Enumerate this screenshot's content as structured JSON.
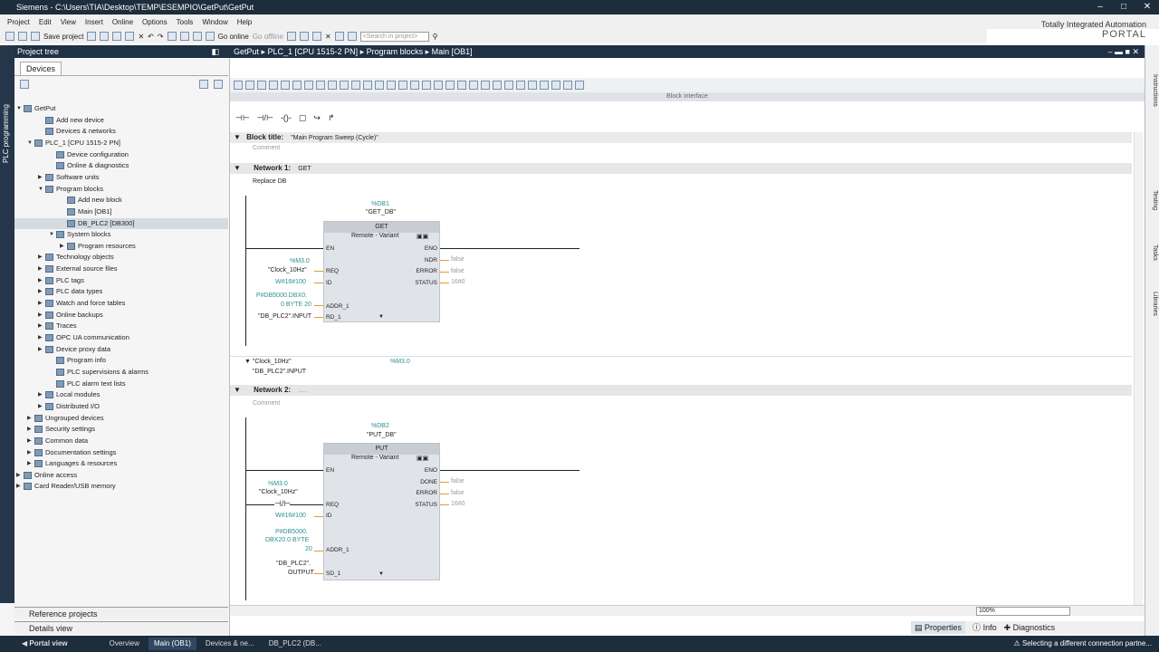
{
  "window": {
    "title": "Siemens - C:\\Users\\TIA\\Desktop\\TEMP\\ESEMPIO\\GetPut\\GetPut"
  },
  "menu": [
    "Project",
    "Edit",
    "View",
    "Insert",
    "Online",
    "Options",
    "Tools",
    "Window",
    "Help"
  ],
  "toolbar": {
    "save": "Save project",
    "go_online": "Go online",
    "go_offline": "Go offline",
    "search_placeholder": "<Search in project>"
  },
  "brand": {
    "line1": "Totally Integrated Automation",
    "line2": "PORTAL"
  },
  "left": {
    "vertical_tab": "PLC programming",
    "header": "Project tree",
    "tab": "Devices"
  },
  "tree": [
    {
      "label": "GetPut",
      "indent": 0,
      "tri": "▼"
    },
    {
      "label": "Add new device",
      "indent": 2,
      "tri": ""
    },
    {
      "label": "Devices & networks",
      "indent": 2,
      "tri": ""
    },
    {
      "label": "PLC_1 [CPU 1515-2 PN]",
      "indent": 1,
      "tri": "▼"
    },
    {
      "label": "Device configuration",
      "indent": 3,
      "tri": ""
    },
    {
      "label": "Online & diagnostics",
      "indent": 3,
      "tri": ""
    },
    {
      "label": "Software units",
      "indent": 2,
      "tri": "▶"
    },
    {
      "label": "Program blocks",
      "indent": 2,
      "tri": "▼"
    },
    {
      "label": "Add new block",
      "indent": 4,
      "tri": ""
    },
    {
      "label": "Main [OB1]",
      "indent": 4,
      "tri": ""
    },
    {
      "label": "DB_PLC2 [DB300]",
      "indent": 4,
      "tri": "",
      "sel": true
    },
    {
      "label": "System blocks",
      "indent": 3,
      "tri": "▼"
    },
    {
      "label": "Program resources",
      "indent": 4,
      "tri": "▶"
    },
    {
      "label": "Technology objects",
      "indent": 2,
      "tri": "▶"
    },
    {
      "label": "External source files",
      "indent": 2,
      "tri": "▶"
    },
    {
      "label": "PLC tags",
      "indent": 2,
      "tri": "▶"
    },
    {
      "label": "PLC data types",
      "indent": 2,
      "tri": "▶"
    },
    {
      "label": "Watch and force tables",
      "indent": 2,
      "tri": "▶"
    },
    {
      "label": "Online backups",
      "indent": 2,
      "tri": "▶"
    },
    {
      "label": "Traces",
      "indent": 2,
      "tri": "▶"
    },
    {
      "label": "OPC UA communication",
      "indent": 2,
      "tri": "▶"
    },
    {
      "label": "Device proxy data",
      "indent": 2,
      "tri": "▶"
    },
    {
      "label": "Program info",
      "indent": 3,
      "tri": ""
    },
    {
      "label": "PLC supervisions & alarms",
      "indent": 3,
      "tri": ""
    },
    {
      "label": "PLC alarm text lists",
      "indent": 3,
      "tri": ""
    },
    {
      "label": "Local modules",
      "indent": 2,
      "tri": "▶"
    },
    {
      "label": "Distributed I/O",
      "indent": 2,
      "tri": "▶"
    },
    {
      "label": "Ungrouped devices",
      "indent": 1,
      "tri": "▶"
    },
    {
      "label": "Security settings",
      "indent": 1,
      "tri": "▶"
    },
    {
      "label": "Common data",
      "indent": 1,
      "tri": "▶"
    },
    {
      "label": "Documentation settings",
      "indent": 1,
      "tri": "▶"
    },
    {
      "label": "Languages & resources",
      "indent": 1,
      "tri": "▶"
    },
    {
      "label": "Online access",
      "indent": 0,
      "tri": "▶"
    },
    {
      "label": "Card Reader/USB memory",
      "indent": 0,
      "tri": "▶"
    }
  ],
  "bottom": {
    "ref": "Reference projects",
    "details": "Details view"
  },
  "editor": {
    "breadcrumb": "GetPut  ▸  PLC_1 [CPU 1515-2 PN]  ▸  Program blocks  ▸  Main [OB1]",
    "block_interface": "Block interface",
    "block_title_label": "Block title:",
    "block_title": "\"Main Program Sweep (Cycle)\"",
    "comment": "Comment",
    "net1": {
      "label": "Network 1:",
      "title": "GET",
      "comment": "Replace DB",
      "db_addr": "%DB1",
      "db_name": "\"GET_DB\"",
      "fb_name": "GET",
      "variant": "Remote - Variant",
      "req_addr": "%M3.0",
      "req_name": "\"Clock_10Hz\"",
      "id_val": "W#16#100",
      "addr1": "P#DB5000.DBX0.",
      "addr1b": "0 BYTE 20",
      "rd1": "\"DB_PLC2\".INPUT",
      "pins_in": [
        "EN",
        "REQ",
        "ID",
        "ADDR_1",
        "RD_1"
      ],
      "pins_out": [
        "ENO",
        "NDR",
        "ERROR",
        "STATUS"
      ],
      "out_vals": [
        "false",
        "false",
        "16#0"
      ],
      "tag_name": "\"Clock_10Hz\"",
      "tag_addr": "%M3.0",
      "tag2": "\"DB_PLC2\".INPUT"
    },
    "net2": {
      "label": "Network 2:",
      "title": ".....",
      "comment": "Comment",
      "db_addr": "%DB2",
      "db_name": "\"PUT_DB\"",
      "fb_name": "PUT",
      "variant": "Remote - Variant",
      "req_addr": "%M3.0",
      "req_name": "\"Clock_10Hz\"",
      "id_val": "W#16#100",
      "addr1": "P#DB5000.",
      "addr1b": "DBX20.0 BYTE",
      "addr1c": "20",
      "sd1a": "\"DB_PLC2\".",
      "sd1b": "OUTPUT",
      "pins_in": [
        "EN",
        "REQ",
        "ID",
        "ADDR_1",
        "SD_1"
      ],
      "pins_out": [
        "ENO",
        "DONE",
        "ERROR",
        "STATUS"
      ],
      "out_vals": [
        "false",
        "false",
        "16#0"
      ]
    }
  },
  "zoom": "100%",
  "right_tabs": [
    "Instructions",
    "Testing",
    "Tasks",
    "Libraries"
  ],
  "props": {
    "properties": "Properties",
    "info": "Info",
    "diagnostics": "Diagnostics"
  },
  "taskbar": {
    "portal": "Portal view",
    "items": [
      "Overview",
      "Main (OB1)",
      "Devices & ne...",
      "DB_PLC2 (DB..."
    ],
    "status": "Selecting a different connection partne..."
  }
}
